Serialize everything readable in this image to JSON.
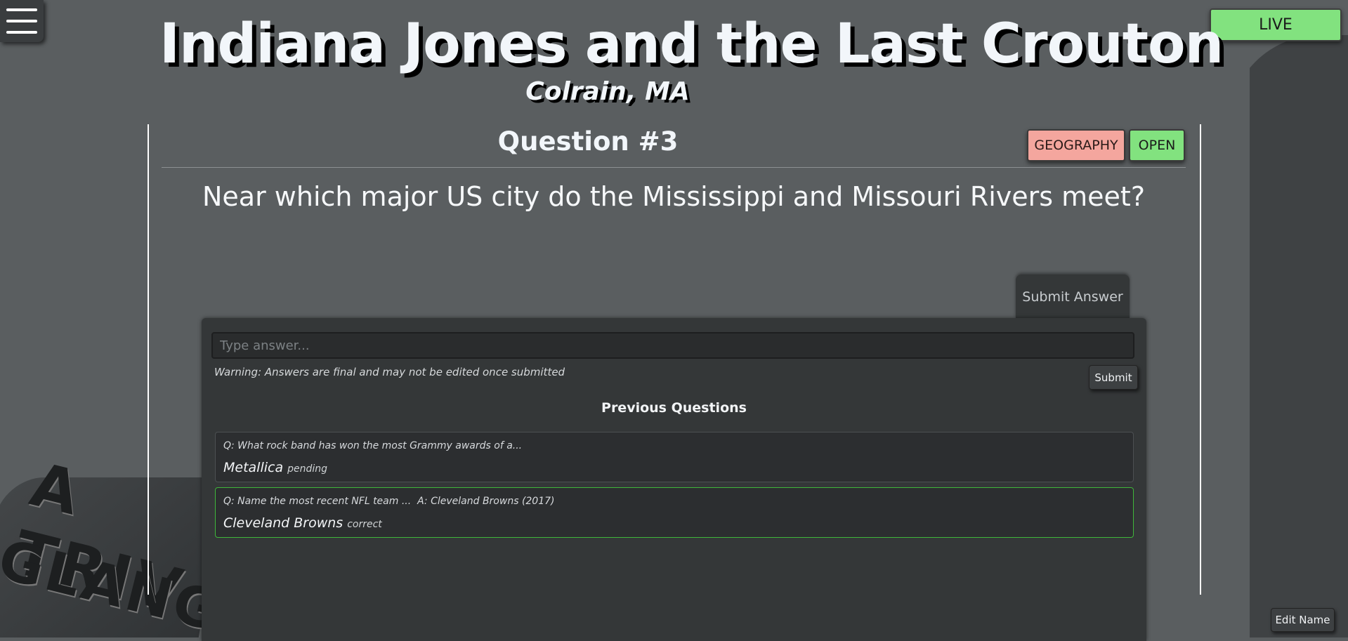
{
  "header": {
    "title": "Indiana Jones and the Last Crouton",
    "location": "Colrain, MA",
    "live_label": "LIVE"
  },
  "logo": {
    "line1": "A TRIV",
    "line2": "GLANG"
  },
  "question": {
    "number_label": "Question #3",
    "category": "GEOGRAPHY",
    "status": "OPEN",
    "text": "Near which major US city do the Mississippi and Missouri Rivers meet?"
  },
  "answer_panel": {
    "tab_label": "Submit Answer",
    "input_placeholder": "Type answer...",
    "input_value": "",
    "warning": "Warning: Answers are final and may not be edited once submitted",
    "submit_label": "Submit"
  },
  "previous": {
    "heading": "Previous Questions",
    "items": [
      {
        "question": "Q: What rock band has won the most Grammy awards of a...",
        "answer": "Metallica",
        "status": "pending"
      },
      {
        "question": "Q: Name the most recent NFL team ...  A: Cleveland Browns (2017)",
        "answer": "Cleveland Browns",
        "status": "correct"
      }
    ]
  },
  "footer": {
    "edit_name_label": "Edit Name"
  },
  "colors": {
    "background": "#5a5e60",
    "panel": "#343738",
    "live_green": "#82e27f",
    "category_pink": "#f4a69e",
    "correct_border": "#3fb73b"
  },
  "icons": {
    "menu": "hamburger-menu-icon"
  }
}
